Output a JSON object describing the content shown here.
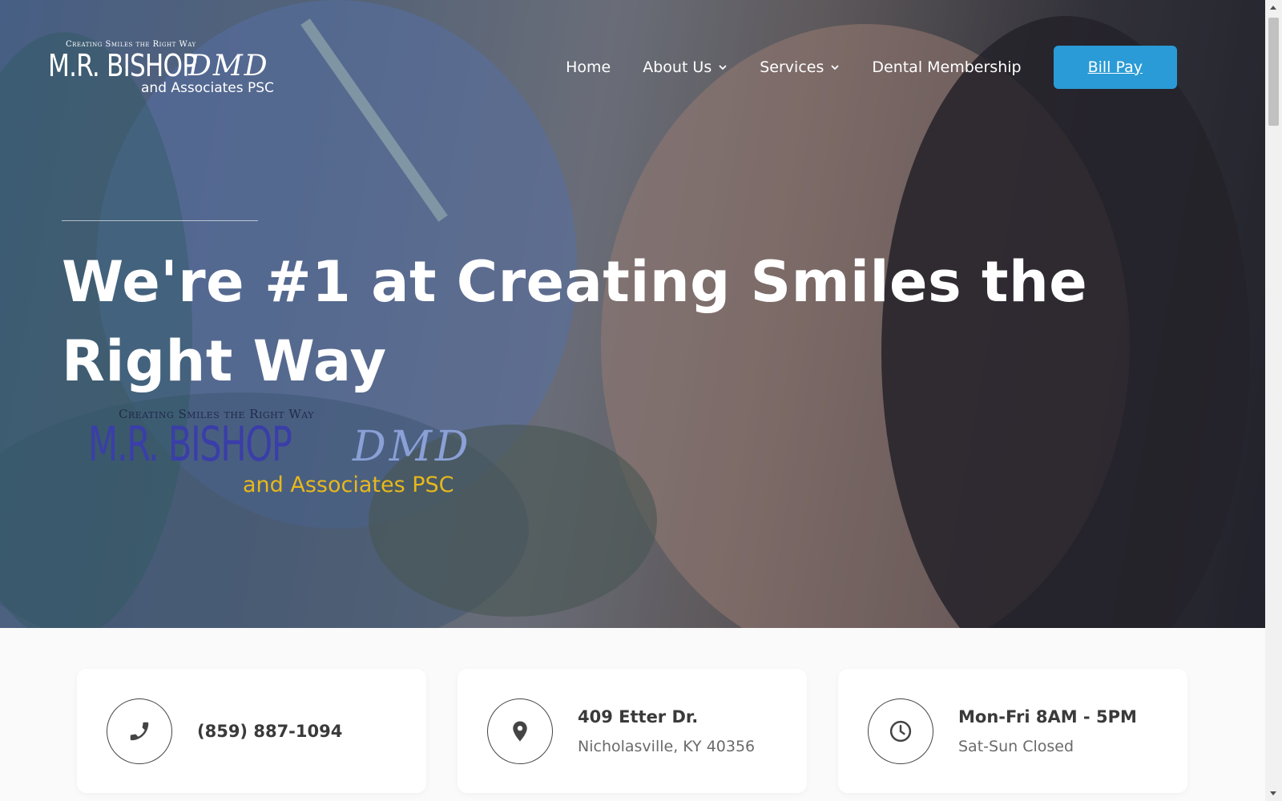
{
  "header": {
    "logo": {
      "tagline": "Creating Smiles the Right Way",
      "name": "M.R. BISHOP",
      "credential": "DMD",
      "subtitle": "and Associates PSC"
    },
    "nav": {
      "home": "Home",
      "about": "About Us",
      "services": "Services",
      "membership": "Dental Membership",
      "bill_pay": "Bill Pay"
    }
  },
  "hero": {
    "title": "We're #1 at Creating Smiles the Right Way",
    "logo": {
      "tagline": "Creating Smiles the Right Way",
      "name": "M.R. BISHOP",
      "credential": "DMD",
      "subtitle": "and Associates PSC"
    }
  },
  "cards": [
    {
      "icon": "phone-icon",
      "title": "(859) 887-1094",
      "subtitle": ""
    },
    {
      "icon": "location-pin-icon",
      "title": "409 Etter Dr.",
      "subtitle": "Nicholasville, KY 40356"
    },
    {
      "icon": "clock-icon",
      "title": "Mon-Fri 8AM - 5PM",
      "subtitle": "Sat-Sun Closed"
    }
  ],
  "colors": {
    "accent": "#2a9bd6",
    "card_text": "#3a3a3a",
    "page_bg": "#fafafa"
  }
}
